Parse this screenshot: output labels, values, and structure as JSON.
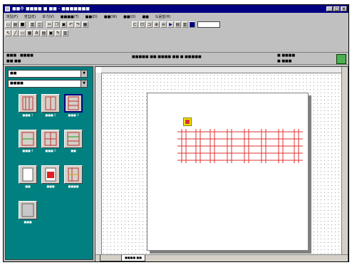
{
  "window": {
    "title": "■■수 ■■■■ ■ ■■ · ■■■■■■■"
  },
  "menubar": {
    "items": [
      "파일(F)",
      "편집(E)",
      "보기(V)",
      "■■■■(T)",
      "■■(D)",
      "■■(W)",
      "■■(O)",
      "■■",
      "도움말(H)"
    ]
  },
  "statusrow": {
    "left_top": "■■■ · ■■■■",
    "left_bottom": "■■ ■■",
    "center": "■■■■■ ■■ ■■■■ ■■ ■ ■■■■■",
    "right_top": "■ ■■■■",
    "right_bottom": "■ ■■■"
  },
  "leftpanel": {
    "combo1": "■■",
    "combo2": "■■■■",
    "tiles": [
      {
        "label": "■■■ 1"
      },
      {
        "label": "■■■ 2"
      },
      {
        "label": "■■■ 3"
      },
      {
        "label": "■■■ 4"
      },
      {
        "label": "■■■ 5"
      },
      {
        "label": "■■"
      },
      {
        "label": "■■"
      },
      {
        "label": "■■■"
      },
      {
        "label": "■■■■"
      },
      {
        "label": "■■■"
      }
    ]
  },
  "canvas": {
    "sheet_tab": "■■■■ ■■"
  },
  "colors": {
    "title_bar": "#000080",
    "panel": "#008080",
    "element_red": "#e03030",
    "selection_yellow": "#f2e600",
    "ok_green": "#4caf50"
  }
}
